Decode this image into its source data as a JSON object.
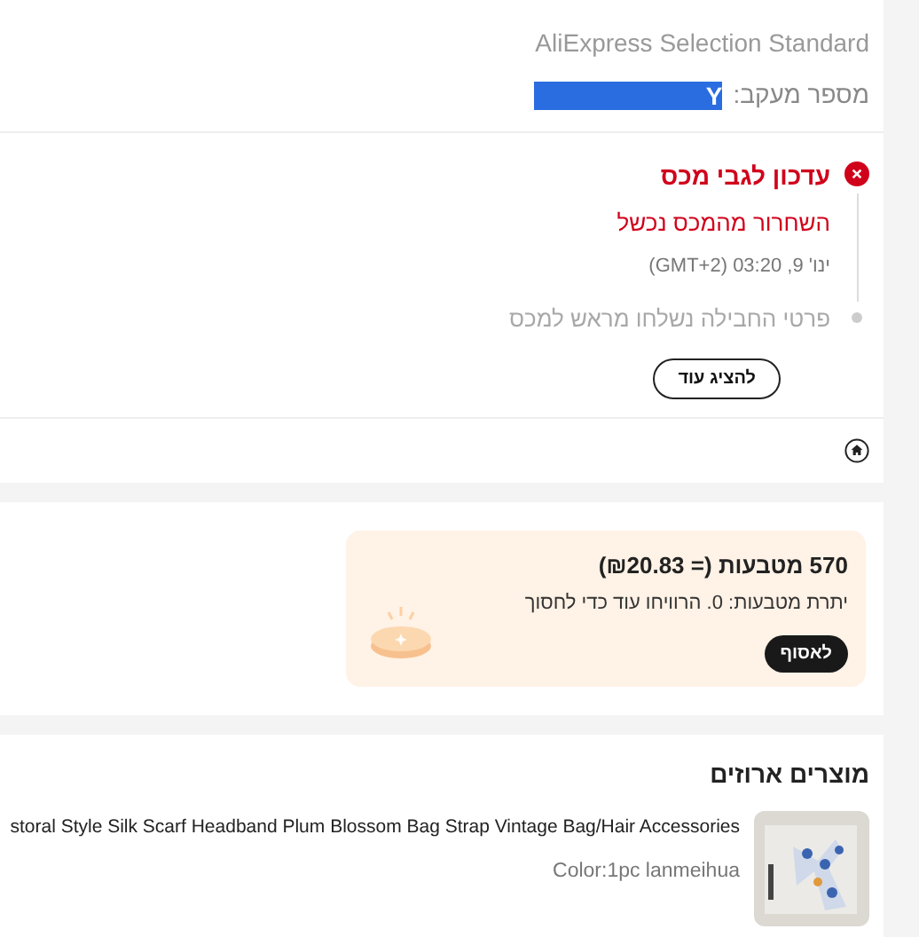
{
  "shipping": {
    "service": "AliExpress Selection Standard",
    "tracking_label": "מספר מעקב:",
    "tracking_number": "Y"
  },
  "timeline": [
    {
      "kind": "failed",
      "title": "עדכון לגבי מכס",
      "description": "השחרור מהמכס נכשל",
      "date": "ינו' 9, 03:20 (GMT+2)"
    },
    {
      "kind": "past",
      "description": "פרטי החבילה נשלחו מראש למכס"
    }
  ],
  "show_more": "להציג עוד",
  "coins": {
    "title": "570 מטבעות (= ₪20.83)",
    "subtitle": "יתרת מטבעות: 0. הרוויחו עוד כדי לחסוך",
    "button": "לאסוף"
  },
  "products": {
    "title": "מוצרים ארוזים",
    "items": [
      {
        "name": "storal Style Silk Scarf Headband Plum Blossom Bag Strap Vintage Bag/Hair Accessories",
        "variant": "Color:1pc lanmeihua"
      }
    ]
  }
}
